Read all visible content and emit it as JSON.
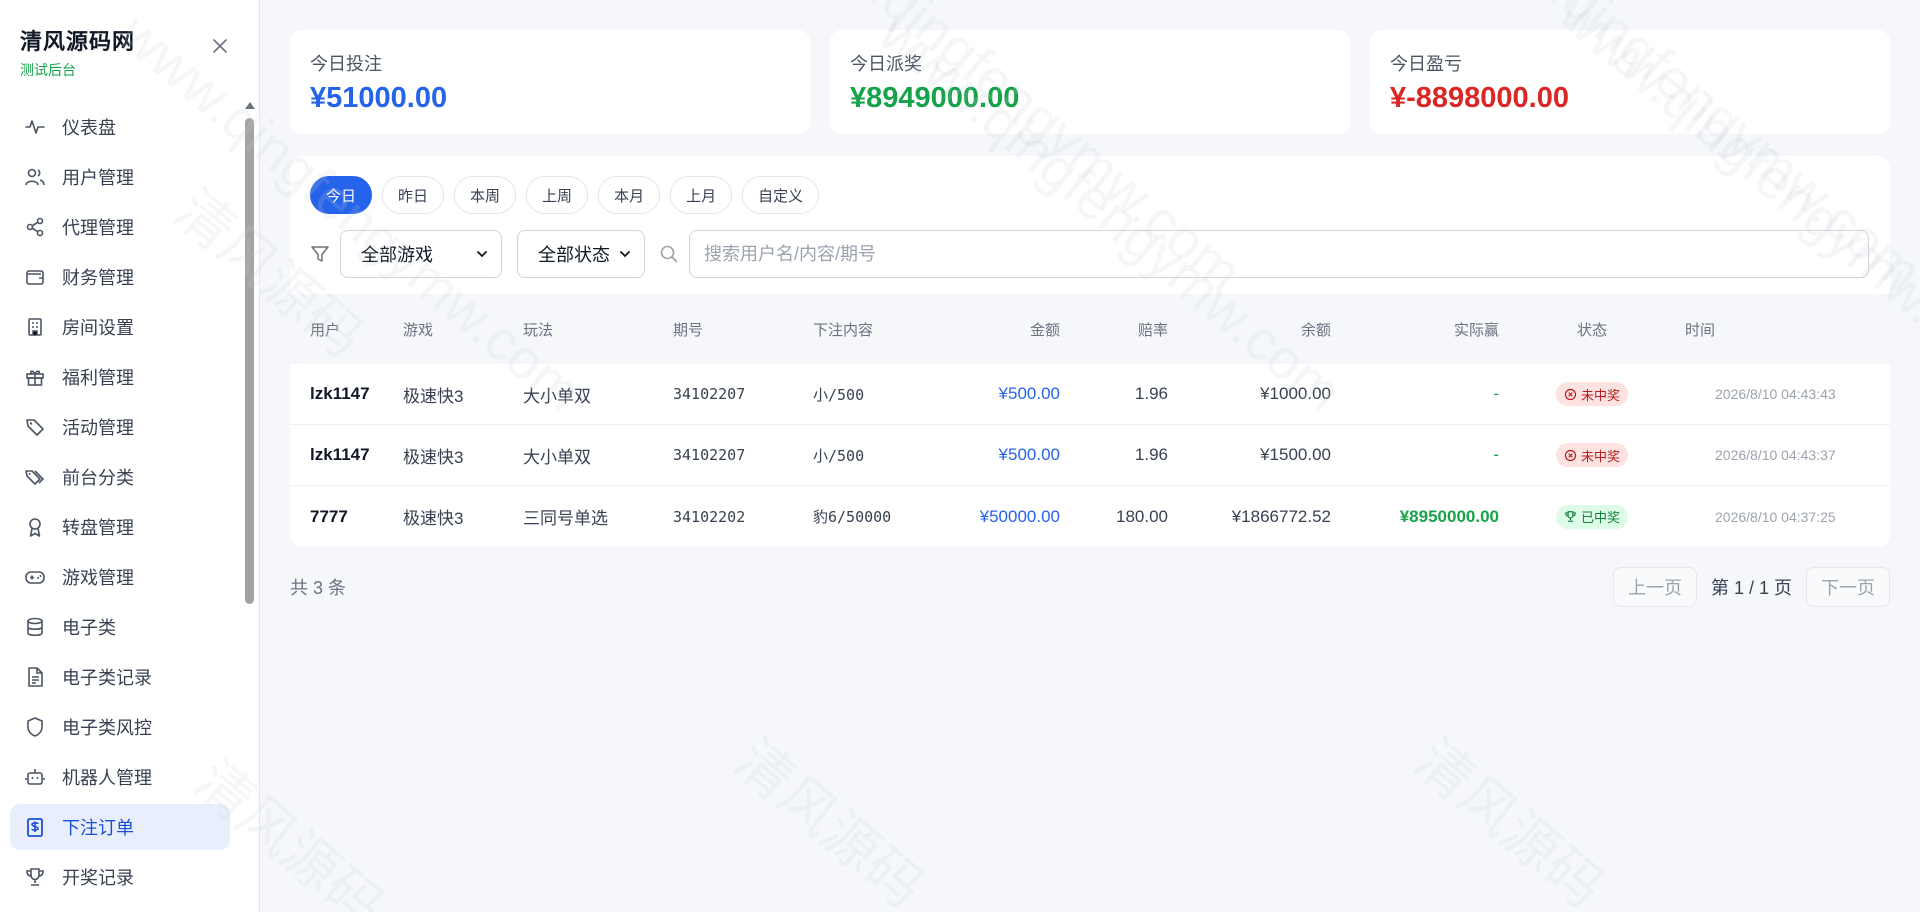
{
  "brand": {
    "title": "清风源码网",
    "subtitle": "测试后台"
  },
  "sidebar": {
    "items": [
      {
        "label": "仪表盘",
        "icon": "activity-icon",
        "active": false
      },
      {
        "label": "用户管理",
        "icon": "users-icon",
        "active": false
      },
      {
        "label": "代理管理",
        "icon": "share-icon",
        "active": false
      },
      {
        "label": "财务管理",
        "icon": "wallet-icon",
        "active": false
      },
      {
        "label": "房间设置",
        "icon": "building-icon",
        "active": false
      },
      {
        "label": "福利管理",
        "icon": "gift-icon",
        "active": false
      },
      {
        "label": "活动管理",
        "icon": "tag-icon",
        "active": false
      },
      {
        "label": "前台分类",
        "icon": "tags-icon",
        "active": false
      },
      {
        "label": "转盘管理",
        "icon": "award-icon",
        "active": false
      },
      {
        "label": "游戏管理",
        "icon": "gamepad-icon",
        "active": false
      },
      {
        "label": "电子类",
        "icon": "database-icon",
        "active": false
      },
      {
        "label": "电子类记录",
        "icon": "file-text-icon",
        "active": false
      },
      {
        "label": "电子类风控",
        "icon": "shield-icon",
        "active": false
      },
      {
        "label": "机器人管理",
        "icon": "bot-icon",
        "active": false
      },
      {
        "label": "下注订单",
        "icon": "dollar-receipt-icon",
        "active": true
      },
      {
        "label": "开奖记录",
        "icon": "trophy-icon",
        "active": false
      }
    ]
  },
  "stats": [
    {
      "label": "今日投注",
      "value": "¥51000.00",
      "color": "#2563eb"
    },
    {
      "label": "今日派奖",
      "value": "¥8949000.00",
      "color": "#16a34a"
    },
    {
      "label": "今日盈亏",
      "value": "¥-8898000.00",
      "color": "#dc2626"
    }
  ],
  "ranges": [
    "今日",
    "昨日",
    "本周",
    "上周",
    "本月",
    "上月",
    "自定义"
  ],
  "active_range": "今日",
  "filters": {
    "game_select": "全部游戏",
    "status_select": "全部状态",
    "search_placeholder": "搜索用户名/内容/期号"
  },
  "table": {
    "headers": [
      "用户",
      "游戏",
      "玩法",
      "期号",
      "下注内容",
      "金额",
      "赔率",
      "余额",
      "实际赢",
      "状态",
      "时间"
    ],
    "rows": [
      {
        "user": "lzk1147",
        "game": "极速快3",
        "play": "大小单双",
        "period": "34102207",
        "content": "小/500",
        "amount": "¥500.00",
        "odds": "1.96",
        "balance": "¥1000.00",
        "win": "-",
        "status": "未中奖",
        "status_type": "lose",
        "time": "2026/8/10 04:43:43"
      },
      {
        "user": "lzk1147",
        "game": "极速快3",
        "play": "大小单双",
        "period": "34102207",
        "content": "小/500",
        "amount": "¥500.00",
        "odds": "1.96",
        "balance": "¥1500.00",
        "win": "-",
        "status": "未中奖",
        "status_type": "lose",
        "time": "2026/8/10 04:43:37"
      },
      {
        "user": "7777",
        "game": "极速快3",
        "play": "三同号单选",
        "period": "34102202",
        "content": "豹6/50000",
        "amount": "¥50000.00",
        "odds": "180.00",
        "balance": "¥1866772.52",
        "win": "¥8950000.00",
        "status": "已中奖",
        "status_type": "win",
        "time": "2026/8/10 04:37:25"
      }
    ]
  },
  "footer": {
    "total": "共 3 条",
    "prev": "上一页",
    "page_info": "第 1 / 1 页",
    "next": "下一页"
  },
  "watermark": {
    "text": "www.qingfengymw.com",
    "text_cn": "清风源码"
  }
}
